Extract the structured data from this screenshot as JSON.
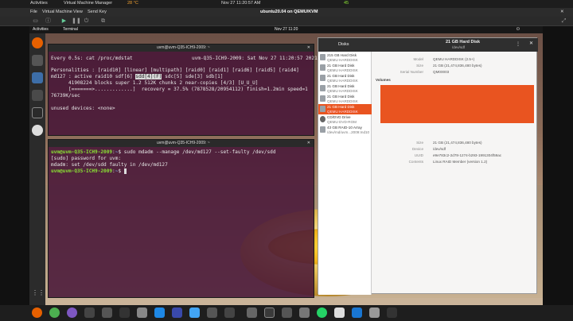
{
  "host": {
    "activities": "Activities",
    "app_menu": "Virtual Machine Manager",
    "temperature": "28 °C",
    "clock": "Nov 27  11:20:57 AM",
    "cpu": "45"
  },
  "vm_window": {
    "title": "ubuntu20.04 on QEMU/KVM",
    "menu": [
      "File",
      "Virtual Machine",
      "View",
      "Send Key"
    ]
  },
  "guest": {
    "activities": "Activities",
    "terminal_menu": "Terminal",
    "clock": "Nov 27  11:20"
  },
  "terminal_top": {
    "title": "uvm@uvm-Q35-ICH9-2009: ~",
    "line1_left": "Every 0.5s: cat /proc/mdstat",
    "line1_right": "uvm-Q35-ICH9-2009: Sat Nov 27 11:20:57 2021",
    "line2": "Personalities : [raid10] [linear] [multipath] [raid0] [raid1] [raid6] [raid5] [raid4]",
    "line3_pre": "md127 : active raid10 sdf[6] ",
    "line3_hl": "sdd[4](F)",
    "line3_post": " sdc[5] sde[3] sdb[1]",
    "line4": "      41908224 blocks super 1.2 512K chunks 2 near-copies [4/3] [U_U_U]",
    "line5": "      [=======>.............]  recovery = 37.5% (7878528/20954112) finish=1.2min speed=1",
    "line6": "76739K/sec",
    "line7": "unused devices: <none>"
  },
  "terminal_bottom": {
    "title": "uvm@uvm-Q35-ICH9-2009: ~",
    "prompt_user": "uvm@uvm-Q35-ICH9-2009",
    "prompt_path": "~",
    "cmd1": "sudo mdadm --manage /dev/md127 --set-faulty /dev/sdd",
    "line2": "[sudo] password for uvm:",
    "line3": "mdadm: set /dev/sdd faulty in /dev/md127"
  },
  "disks": {
    "app_label": "Disks",
    "header_title": "21 GB Hard Disk",
    "header_sub": "/dev/sdf",
    "list": [
      {
        "l1": "215 GB Hard Disk",
        "l2": "QEMU HARDDISK"
      },
      {
        "l1": "21 GB Hard Disk",
        "l2": "QEMU HARDDISK"
      },
      {
        "l1": "21 GB Hard Disk",
        "l2": "QEMU HARDDISK"
      },
      {
        "l1": "21 GB Hard Disk",
        "l2": "QEMU HARDDISK"
      },
      {
        "l1": "21 GB Hard Disk",
        "l2": "QEMU HARDDISK"
      },
      {
        "l1": "21 GB Hard Disk",
        "l2": "QEMU HARDDISK"
      },
      {
        "l1": "CD/DVD Drive",
        "l2": "QEMU DVD-ROM"
      },
      {
        "l1": "43 GB RAID-10 Array",
        "l2": "/dev/md/uvm...2009:md10"
      }
    ],
    "selected_index": 5,
    "props": [
      {
        "k": "Model",
        "v": "QEMU HARDDISK (2.5+)"
      },
      {
        "k": "Size",
        "v": "21 GB (21,474,836,480 bytes)"
      },
      {
        "k": "Serial Number",
        "v": "QM00003"
      }
    ],
    "volumes_label": "Volumes",
    "vol_props": [
      {
        "k": "Size",
        "v": "21 GB (21,474,836,480 bytes)"
      },
      {
        "k": "Device",
        "v": "/dev/sdf"
      },
      {
        "k": "UUID",
        "v": "e9e783c2-2d78-1274-b293-1991304f59ac"
      },
      {
        "k": "Contents",
        "v": "Linux RAID Member (version 1.2)"
      }
    ],
    "volume_color": "#e95420"
  }
}
